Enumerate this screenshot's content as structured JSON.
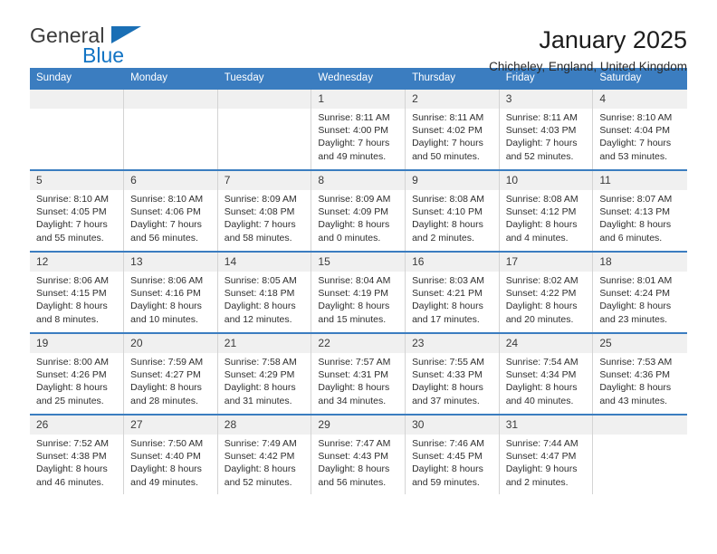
{
  "brand": {
    "name_top": "General",
    "name_bottom": "Blue",
    "color_top": "#3b3b3b",
    "color_bottom": "#1274c4",
    "triangle_color": "#1a6fb5"
  },
  "header": {
    "title": "January 2025",
    "subtitle": "Chicheley, England, United Kingdom"
  },
  "theme": {
    "header_bg": "#3b7dc0",
    "header_text": "#ffffff",
    "daynum_bg": "#f0f0f0",
    "row_border": "#3b7dc0",
    "cell_border": "#d4d4d4"
  },
  "weekdays": [
    "Sunday",
    "Monday",
    "Tuesday",
    "Wednesday",
    "Thursday",
    "Friday",
    "Saturday"
  ],
  "labels": {
    "sunrise_prefix": "Sunrise:",
    "sunset_prefix": "Sunset:",
    "daylight_prefix": "Daylight:"
  },
  "weeks": [
    [
      {
        "day": "",
        "empty": true
      },
      {
        "day": "",
        "empty": true
      },
      {
        "day": "",
        "empty": true
      },
      {
        "day": "1",
        "sunrise": "Sunrise: 8:11 AM",
        "sunset": "Sunset: 4:00 PM",
        "daylight_l1": "Daylight: 7 hours",
        "daylight_l2": "and 49 minutes."
      },
      {
        "day": "2",
        "sunrise": "Sunrise: 8:11 AM",
        "sunset": "Sunset: 4:02 PM",
        "daylight_l1": "Daylight: 7 hours",
        "daylight_l2": "and 50 minutes."
      },
      {
        "day": "3",
        "sunrise": "Sunrise: 8:11 AM",
        "sunset": "Sunset: 4:03 PM",
        "daylight_l1": "Daylight: 7 hours",
        "daylight_l2": "and 52 minutes."
      },
      {
        "day": "4",
        "sunrise": "Sunrise: 8:10 AM",
        "sunset": "Sunset: 4:04 PM",
        "daylight_l1": "Daylight: 7 hours",
        "daylight_l2": "and 53 minutes."
      }
    ],
    [
      {
        "day": "5",
        "sunrise": "Sunrise: 8:10 AM",
        "sunset": "Sunset: 4:05 PM",
        "daylight_l1": "Daylight: 7 hours",
        "daylight_l2": "and 55 minutes."
      },
      {
        "day": "6",
        "sunrise": "Sunrise: 8:10 AM",
        "sunset": "Sunset: 4:06 PM",
        "daylight_l1": "Daylight: 7 hours",
        "daylight_l2": "and 56 minutes."
      },
      {
        "day": "7",
        "sunrise": "Sunrise: 8:09 AM",
        "sunset": "Sunset: 4:08 PM",
        "daylight_l1": "Daylight: 7 hours",
        "daylight_l2": "and 58 minutes."
      },
      {
        "day": "8",
        "sunrise": "Sunrise: 8:09 AM",
        "sunset": "Sunset: 4:09 PM",
        "daylight_l1": "Daylight: 8 hours",
        "daylight_l2": "and 0 minutes."
      },
      {
        "day": "9",
        "sunrise": "Sunrise: 8:08 AM",
        "sunset": "Sunset: 4:10 PM",
        "daylight_l1": "Daylight: 8 hours",
        "daylight_l2": "and 2 minutes."
      },
      {
        "day": "10",
        "sunrise": "Sunrise: 8:08 AM",
        "sunset": "Sunset: 4:12 PM",
        "daylight_l1": "Daylight: 8 hours",
        "daylight_l2": "and 4 minutes."
      },
      {
        "day": "11",
        "sunrise": "Sunrise: 8:07 AM",
        "sunset": "Sunset: 4:13 PM",
        "daylight_l1": "Daylight: 8 hours",
        "daylight_l2": "and 6 minutes."
      }
    ],
    [
      {
        "day": "12",
        "sunrise": "Sunrise: 8:06 AM",
        "sunset": "Sunset: 4:15 PM",
        "daylight_l1": "Daylight: 8 hours",
        "daylight_l2": "and 8 minutes."
      },
      {
        "day": "13",
        "sunrise": "Sunrise: 8:06 AM",
        "sunset": "Sunset: 4:16 PM",
        "daylight_l1": "Daylight: 8 hours",
        "daylight_l2": "and 10 minutes."
      },
      {
        "day": "14",
        "sunrise": "Sunrise: 8:05 AM",
        "sunset": "Sunset: 4:18 PM",
        "daylight_l1": "Daylight: 8 hours",
        "daylight_l2": "and 12 minutes."
      },
      {
        "day": "15",
        "sunrise": "Sunrise: 8:04 AM",
        "sunset": "Sunset: 4:19 PM",
        "daylight_l1": "Daylight: 8 hours",
        "daylight_l2": "and 15 minutes."
      },
      {
        "day": "16",
        "sunrise": "Sunrise: 8:03 AM",
        "sunset": "Sunset: 4:21 PM",
        "daylight_l1": "Daylight: 8 hours",
        "daylight_l2": "and 17 minutes."
      },
      {
        "day": "17",
        "sunrise": "Sunrise: 8:02 AM",
        "sunset": "Sunset: 4:22 PM",
        "daylight_l1": "Daylight: 8 hours",
        "daylight_l2": "and 20 minutes."
      },
      {
        "day": "18",
        "sunrise": "Sunrise: 8:01 AM",
        "sunset": "Sunset: 4:24 PM",
        "daylight_l1": "Daylight: 8 hours",
        "daylight_l2": "and 23 minutes."
      }
    ],
    [
      {
        "day": "19",
        "sunrise": "Sunrise: 8:00 AM",
        "sunset": "Sunset: 4:26 PM",
        "daylight_l1": "Daylight: 8 hours",
        "daylight_l2": "and 25 minutes."
      },
      {
        "day": "20",
        "sunrise": "Sunrise: 7:59 AM",
        "sunset": "Sunset: 4:27 PM",
        "daylight_l1": "Daylight: 8 hours",
        "daylight_l2": "and 28 minutes."
      },
      {
        "day": "21",
        "sunrise": "Sunrise: 7:58 AM",
        "sunset": "Sunset: 4:29 PM",
        "daylight_l1": "Daylight: 8 hours",
        "daylight_l2": "and 31 minutes."
      },
      {
        "day": "22",
        "sunrise": "Sunrise: 7:57 AM",
        "sunset": "Sunset: 4:31 PM",
        "daylight_l1": "Daylight: 8 hours",
        "daylight_l2": "and 34 minutes."
      },
      {
        "day": "23",
        "sunrise": "Sunrise: 7:55 AM",
        "sunset": "Sunset: 4:33 PM",
        "daylight_l1": "Daylight: 8 hours",
        "daylight_l2": "and 37 minutes."
      },
      {
        "day": "24",
        "sunrise": "Sunrise: 7:54 AM",
        "sunset": "Sunset: 4:34 PM",
        "daylight_l1": "Daylight: 8 hours",
        "daylight_l2": "and 40 minutes."
      },
      {
        "day": "25",
        "sunrise": "Sunrise: 7:53 AM",
        "sunset": "Sunset: 4:36 PM",
        "daylight_l1": "Daylight: 8 hours",
        "daylight_l2": "and 43 minutes."
      }
    ],
    [
      {
        "day": "26",
        "sunrise": "Sunrise: 7:52 AM",
        "sunset": "Sunset: 4:38 PM",
        "daylight_l1": "Daylight: 8 hours",
        "daylight_l2": "and 46 minutes."
      },
      {
        "day": "27",
        "sunrise": "Sunrise: 7:50 AM",
        "sunset": "Sunset: 4:40 PM",
        "daylight_l1": "Daylight: 8 hours",
        "daylight_l2": "and 49 minutes."
      },
      {
        "day": "28",
        "sunrise": "Sunrise: 7:49 AM",
        "sunset": "Sunset: 4:42 PM",
        "daylight_l1": "Daylight: 8 hours",
        "daylight_l2": "and 52 minutes."
      },
      {
        "day": "29",
        "sunrise": "Sunrise: 7:47 AM",
        "sunset": "Sunset: 4:43 PM",
        "daylight_l1": "Daylight: 8 hours",
        "daylight_l2": "and 56 minutes."
      },
      {
        "day": "30",
        "sunrise": "Sunrise: 7:46 AM",
        "sunset": "Sunset: 4:45 PM",
        "daylight_l1": "Daylight: 8 hours",
        "daylight_l2": "and 59 minutes."
      },
      {
        "day": "31",
        "sunrise": "Sunrise: 7:44 AM",
        "sunset": "Sunset: 4:47 PM",
        "daylight_l1": "Daylight: 9 hours",
        "daylight_l2": "and 2 minutes."
      },
      {
        "day": "",
        "empty": true
      }
    ]
  ]
}
